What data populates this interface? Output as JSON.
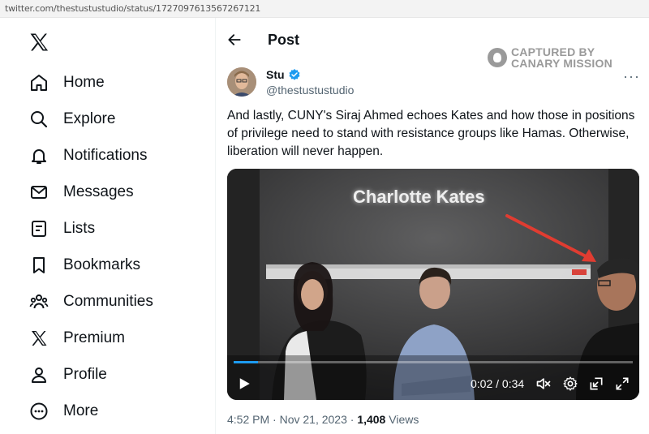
{
  "browser": {
    "url": "twitter.com/thestustustudio/status/1727097613567267121"
  },
  "sidebar": {
    "items": [
      {
        "label": "Home",
        "icon": "home-icon"
      },
      {
        "label": "Explore",
        "icon": "search-icon"
      },
      {
        "label": "Notifications",
        "icon": "bell-icon"
      },
      {
        "label": "Messages",
        "icon": "mail-icon"
      },
      {
        "label": "Lists",
        "icon": "list-icon"
      },
      {
        "label": "Bookmarks",
        "icon": "bookmark-icon"
      },
      {
        "label": "Communities",
        "icon": "people-icon"
      },
      {
        "label": "Premium",
        "icon": "x-logo-icon"
      },
      {
        "label": "Profile",
        "icon": "person-icon"
      },
      {
        "label": "More",
        "icon": "more-circle-icon"
      }
    ]
  },
  "header": {
    "title": "Post"
  },
  "watermark": {
    "line1": "CAPTURED BY",
    "line2": "CANARY MISSION"
  },
  "post": {
    "author_name": "Stu",
    "author_handle": "@thestustustudio",
    "text": "And lastly, CUNY's Siraj Ahmed echoes Kates and how those in positions of privilege need to stand with resistance groups like Hamas. Otherwise, liberation will never happen.",
    "timestamp": "4:52 PM · Nov 21, 2023 · ",
    "views_count": "1,408",
    "views_label": " Views"
  },
  "video": {
    "caption": "Charlotte Kates",
    "time": "0:02 / 0:34",
    "progress": 0.06
  },
  "colors": {
    "verified": "#1d9bf0",
    "accent": "#1d9bf0",
    "arrow": "#e03c31"
  }
}
